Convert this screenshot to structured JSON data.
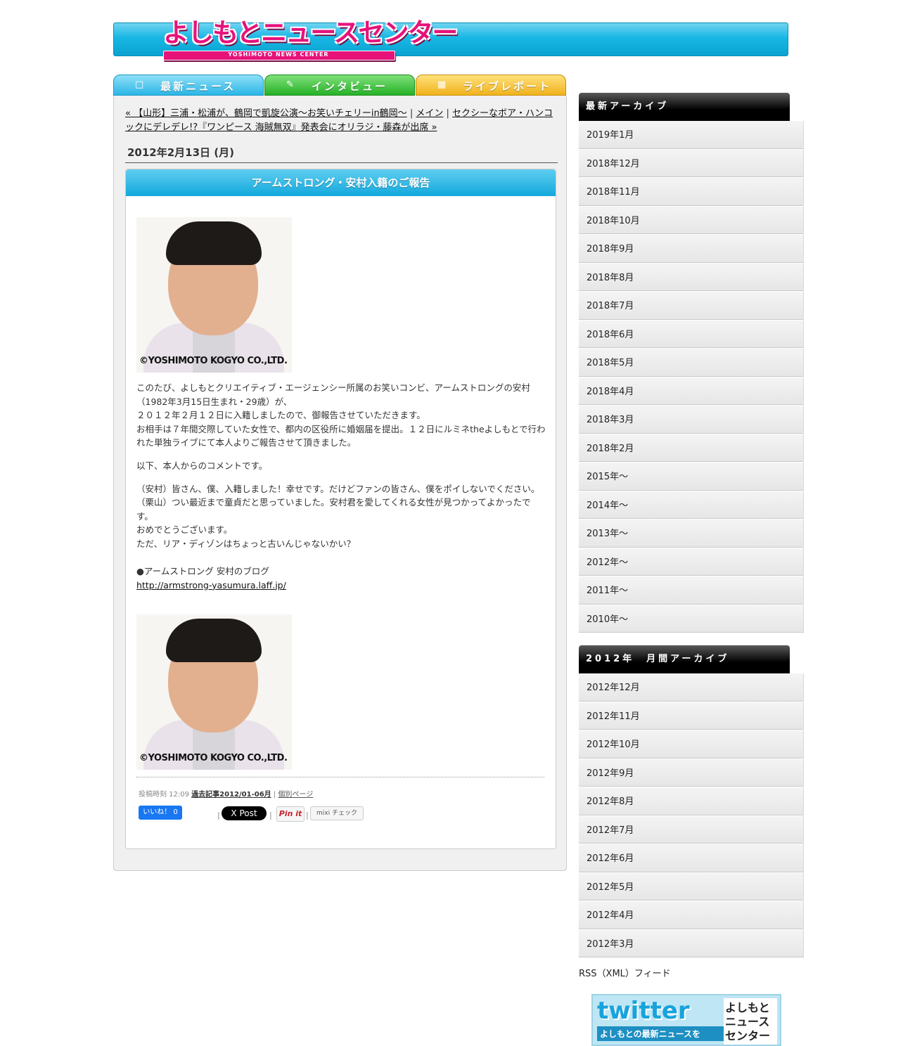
{
  "header": {
    "logo_jp": "よしもとニュースセンター",
    "logo_en": "YOSHIMOTO NEWS CENTER"
  },
  "tabs": [
    {
      "label": "最新ニュース"
    },
    {
      "label": "インタビュー"
    },
    {
      "label": "ライブレポート"
    }
  ],
  "nav": {
    "prev_link": "« 【山形】三浦・松浦が、鶴岡で凱旋公演～お笑いチェリーin鶴岡～",
    "sep1": " | ",
    "main_link": "メイン",
    "sep2": " | ",
    "next_link": "セクシーなボア・ハンコックにデレデレ!?『ワンピース 海賊無双』発表会にオリラジ・藤森が出席 »"
  },
  "entry": {
    "date": "2012年2月13日 (月)",
    "title": "アームストロング・安村入籍のご報告",
    "photo_copyright": "©YOSHIMOTO KOGYO CO.,LTD.",
    "paragraphs": [
      "このたび、よしもとクリエイティブ・エージェンシー所属のお笑いコンビ、アームストロングの安村（1982年3月15日生まれ・29歳）が、",
      "２０１２年２月１２日に入籍しましたので、御報告させていただきます。",
      "お相手は７年間交際していた女性で、都内の区役所に婚姻届を提出。１２日にルミネtheよしもとで行われた単独ライブにて本人よりご報告させて頂きました。",
      "以下、本人からのコメントです。",
      "（安村）皆さん、僕、入籍しました！幸せです。だけどファンの皆さん、僕をポイしないでください。",
      "（栗山）つい最近まで童貞だと思っていました。安村君を愛してくれる女性が見つかってよかったです。",
      "おめでとうございます。",
      "ただ、リア・ディゾンはちょっと古いんじゃないかい？",
      "●アームストロング 安村のブログ",
      "http://armstrong-yasumura.laff.jp/"
    ],
    "meta_time": "投稿時刻 12:09",
    "meta_category": "過去記事2012/01-06月",
    "meta_sep": " | ",
    "meta_permalink": "個別ページ",
    "social": {
      "facebook": "いいね！ 0",
      "twitter": "X Post",
      "pinterest": "Pin it",
      "mixi": "mixi チェック",
      "pipe": "|"
    }
  },
  "sidebar": {
    "archive_title": "最新アーカイブ",
    "archive_items": [
      "2019年1月",
      "2018年12月",
      "2018年11月",
      "2018年10月",
      "2018年9月",
      "2018年8月",
      "2018年7月",
      "2018年6月",
      "2018年5月",
      "2018年4月",
      "2018年3月",
      "2018年2月",
      "2015年～",
      "2014年～",
      "2013年～",
      "2012年～",
      "2011年～",
      "2010年～"
    ],
    "monthly_title": "2012年　月間アーカイブ",
    "monthly_items": [
      "2012年12月",
      "2012年11月",
      "2012年10月",
      "2012年9月",
      "2012年8月",
      "2012年7月",
      "2012年6月",
      "2012年5月",
      "2012年4月",
      "2012年3月"
    ],
    "rss": "RSS（XML）フィード",
    "twitter_banner": {
      "word": "twitter",
      "sub": "よしもとの最新ニュースを",
      "yn": "よしもとニュースセンター"
    }
  }
}
